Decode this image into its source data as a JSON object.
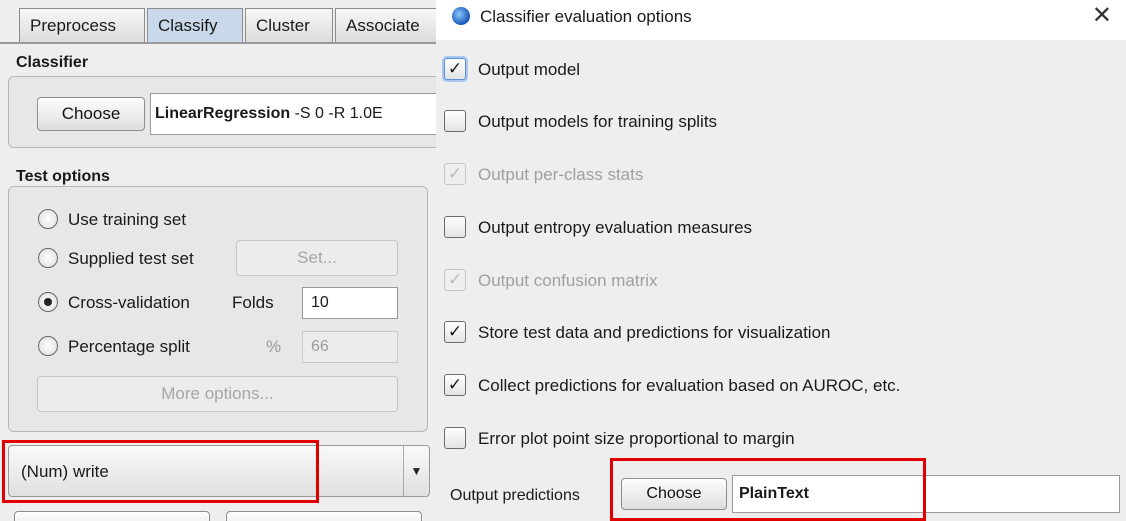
{
  "tabs": [
    {
      "label": "Preprocess",
      "active": false
    },
    {
      "label": "Classify",
      "active": true
    },
    {
      "label": "Cluster",
      "active": false
    },
    {
      "label": "Associate",
      "active": false
    }
  ],
  "classifier": {
    "section_title": "Classifier",
    "choose_label": "Choose",
    "name": "LinearRegression",
    "options": " -S 0 -R 1.0E"
  },
  "test_options": {
    "section_title": "Test options",
    "use_training_set": "Use training set",
    "supplied_test_set": "Supplied test set",
    "set_button": "Set...",
    "cross_validation": "Cross-validation",
    "folds_label": "Folds",
    "folds_value": "10",
    "percentage_split": "Percentage split",
    "percent_symbol": "%",
    "percent_value": "66",
    "more_options": "More options...",
    "selected": "cross_validation"
  },
  "class_attribute": {
    "value": "(Num) write"
  },
  "dialog": {
    "title": "Classifier evaluation options",
    "close_symbol": "✕",
    "options": [
      {
        "label": "Output model",
        "checked": true,
        "enabled": true
      },
      {
        "label": "Output models for training splits",
        "checked": false,
        "enabled": true
      },
      {
        "label": "Output per-class stats",
        "checked": true,
        "enabled": false
      },
      {
        "label": "Output entropy evaluation measures",
        "checked": false,
        "enabled": true
      },
      {
        "label": "Output confusion matrix",
        "checked": true,
        "enabled": false
      },
      {
        "label": "Store test data and predictions for visualization",
        "checked": true,
        "enabled": true
      },
      {
        "label": "Collect predictions for evaluation based on AUROC, etc.",
        "checked": true,
        "enabled": true
      },
      {
        "label": "Error plot point size proportional to margin",
        "checked": false,
        "enabled": true
      }
    ],
    "output_predictions_label": "Output predictions",
    "output_predictions_choose": "Choose",
    "output_predictions_value": "PlainText"
  },
  "colors": {
    "highlight": "#e00000",
    "active_tab": "#c9d8ea"
  },
  "icons": {
    "dialog_icon": "weka-bird-icon",
    "dropdown": "dropdown-arrow-icon",
    "check": "checkmark-icon"
  }
}
